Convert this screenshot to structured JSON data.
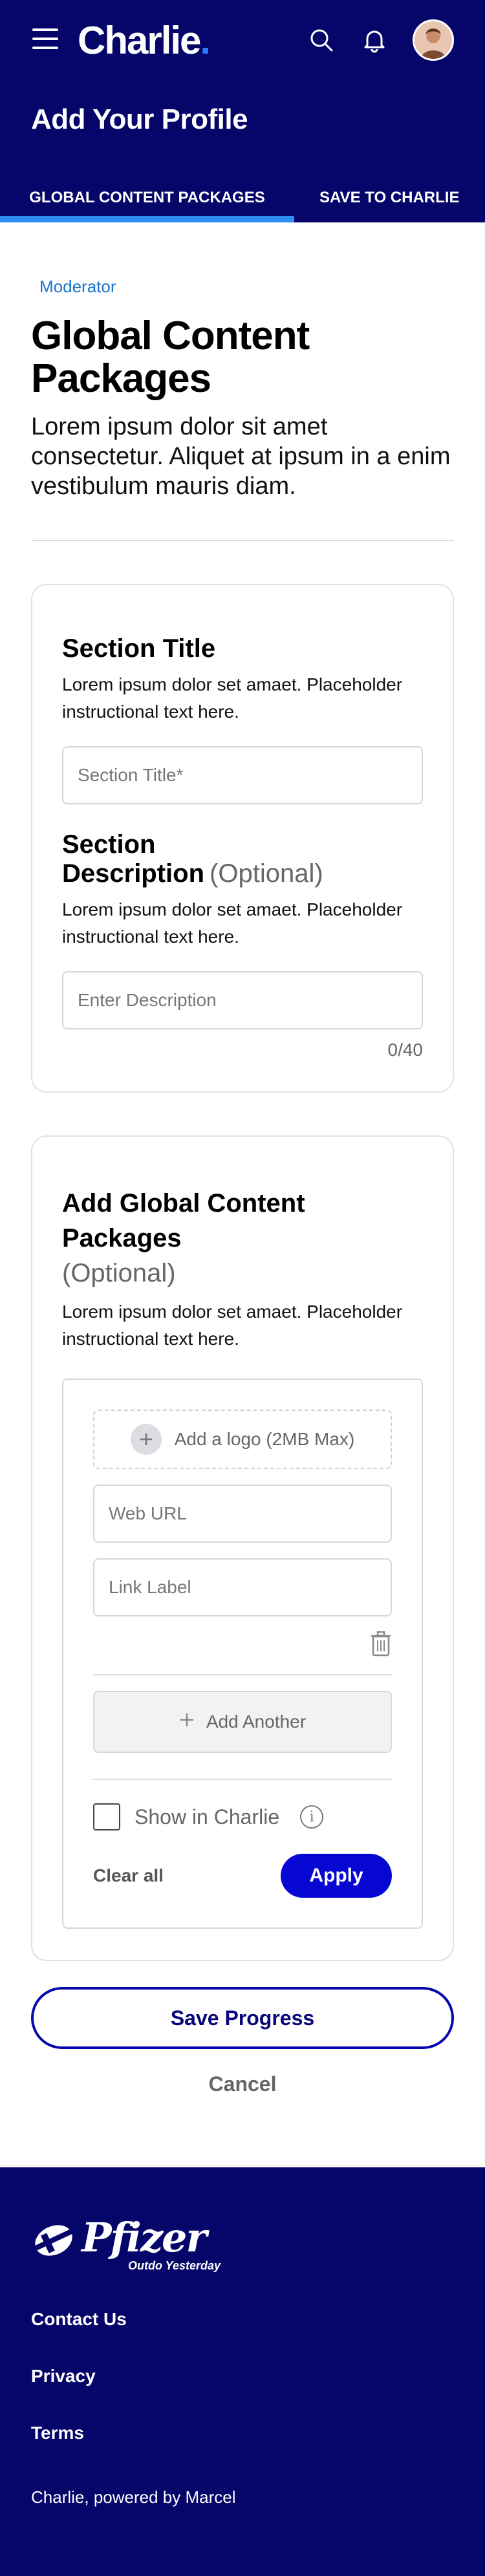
{
  "header": {
    "brand": "Charlie",
    "brand_dot": ".",
    "page_title": "Add Your Profile",
    "tabs": [
      {
        "label": "GLOBAL CONTENT PACKAGES",
        "active": true
      },
      {
        "label": "SAVE TO CHARLIE",
        "active": false
      }
    ],
    "icons": [
      "menu-icon",
      "search-icon",
      "bell-icon",
      "user-avatar"
    ],
    "colors": {
      "background": "#05056a",
      "tab_indicator": "#2c8cf0",
      "brand_dot": "#2f7bff"
    }
  },
  "main": {
    "role": "Moderator",
    "title": "Global Content Packages",
    "lead": "Lorem ipsum dolor sit amet consectetur. Aliquet at ipsum in a enim vestibulum mauris diam.",
    "section_card": {
      "title_heading": "Section Title",
      "title_helper": "Lorem ipsum dolor set amaet. Placeholder instructional text here.",
      "title_placeholder": "Section Title*",
      "description_heading": "Section Description",
      "description_optional": "(Optional)",
      "description_helper": "Lorem ipsum dolor set amaet. Placeholder instructional text here.",
      "description_placeholder": "Enter Description",
      "counter": "0/40"
    },
    "packages_card": {
      "heading": "Add Global Content Packages",
      "optional": "(Optional)",
      "helper": "Lorem ipsum dolor set amaet. Placeholder instructional text here.",
      "upload_label": "Add a logo (2MB Max)",
      "web_url_placeholder": "Web URL",
      "link_label_placeholder": "Link Label",
      "add_another_label": "Add Another",
      "show_in_charlie_label": "Show in Charlie",
      "show_in_charlie_checked": false,
      "info_glyph": "i",
      "clear_all_label": "Clear all",
      "apply_label": "Apply"
    },
    "save_progress_label": "Save Progress",
    "cancel_label": "Cancel",
    "colors": {
      "link_blue": "#1a73c8",
      "primary_button": "#0707d4"
    }
  },
  "footer": {
    "logo_word": "Pfizer",
    "logo_tagline": "Outdo Yesterday",
    "links": [
      "Contact Us",
      "Privacy",
      "Terms"
    ],
    "powered_by": "Charlie, powered by Marcel"
  }
}
